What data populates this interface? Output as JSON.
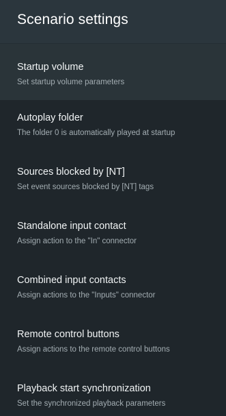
{
  "header": {
    "title": "Scenario settings"
  },
  "settings": {
    "items": [
      {
        "title": "Startup volume",
        "subtitle": "Set startup volume parameters"
      },
      {
        "title": "Autoplay folder",
        "subtitle": "The folder 0 is automatically played at startup"
      },
      {
        "title": "Sources blocked by [NT]",
        "subtitle": "Set event sources blocked by [NT] tags"
      },
      {
        "title": "Standalone input contact",
        "subtitle": "Assign action to the \"In\" connector"
      },
      {
        "title": "Combined input contacts",
        "subtitle": "Assign actions to the \"Inputs\" connector"
      },
      {
        "title": "Remote control buttons",
        "subtitle": "Assign actions to the remote control buttons"
      },
      {
        "title": "Playback start synchronization",
        "subtitle": "Set the synchronized playback parameters"
      }
    ]
  },
  "colors": {
    "background": "#1f262b",
    "header_background": "#2b363d",
    "selected_item_background": "#2a3439",
    "title_text": "#f1f4f5",
    "subtitle_text": "#a3adb2"
  }
}
